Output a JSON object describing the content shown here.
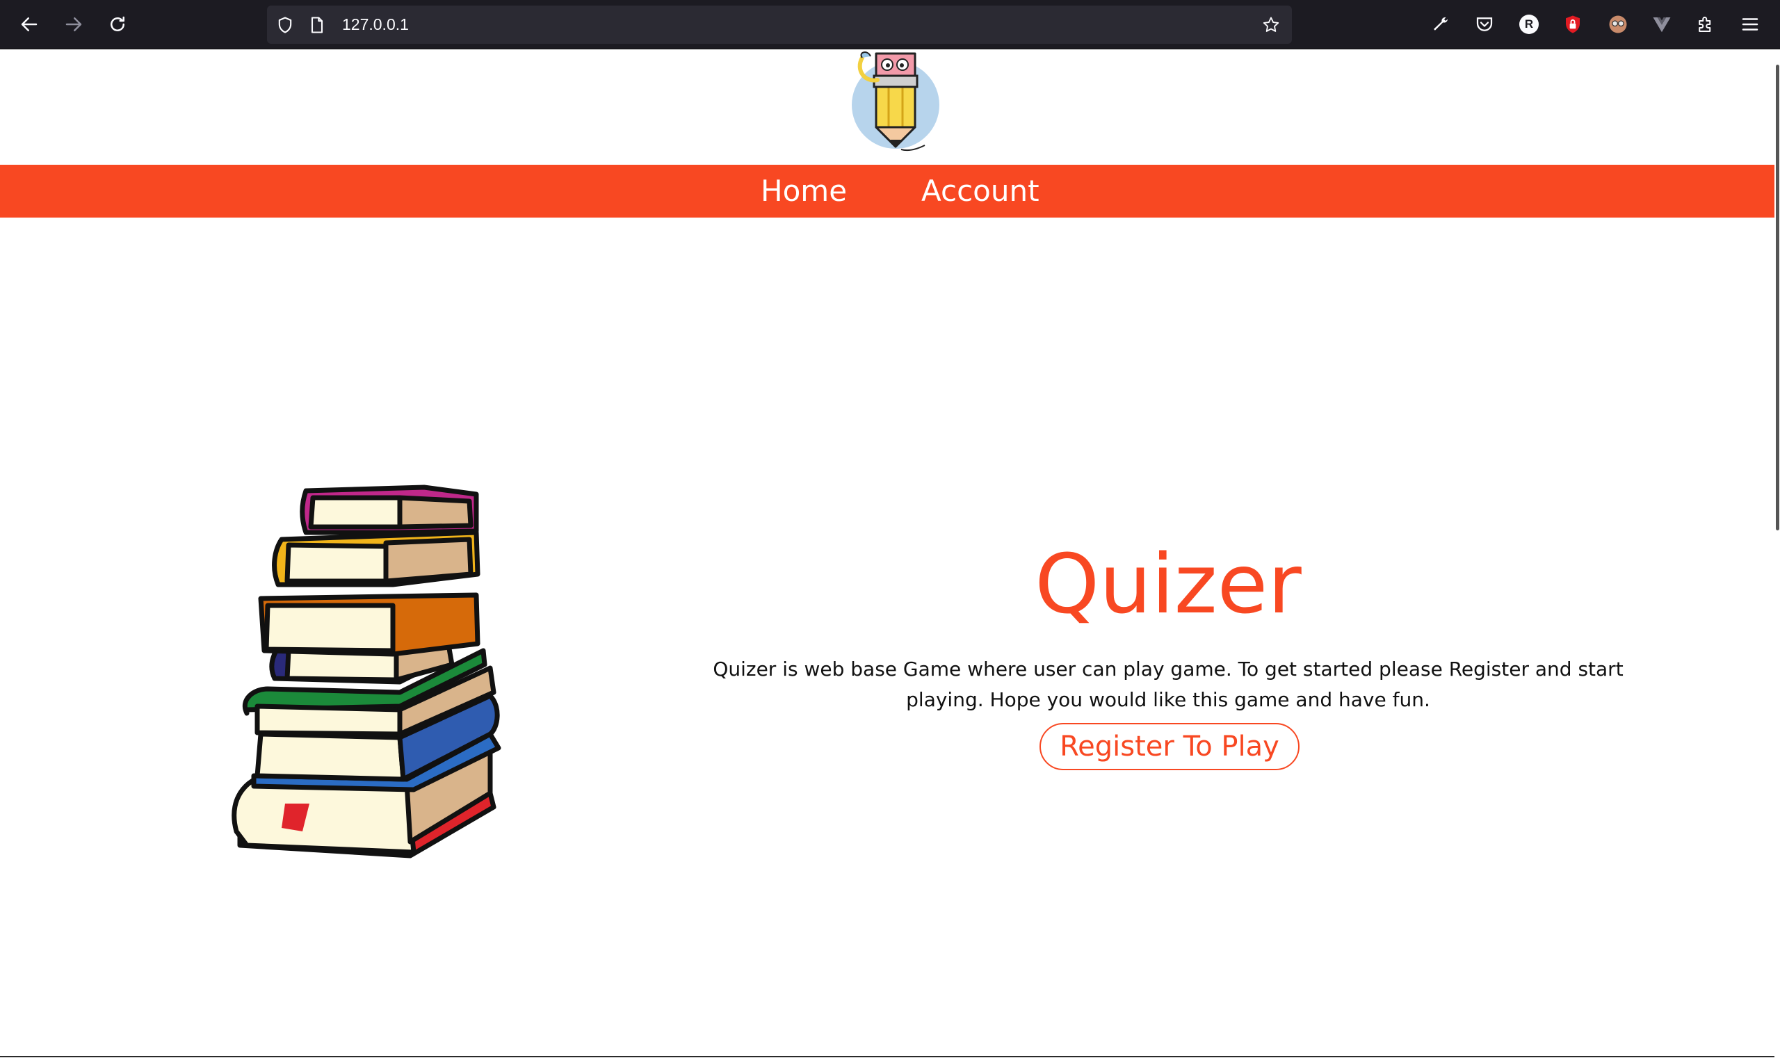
{
  "browser": {
    "url": "127.0.0.1",
    "icons": {
      "back": "arrow-left-icon",
      "forward": "arrow-right-icon",
      "reload": "reload-icon",
      "tracking": "shield-icon",
      "page": "page-icon",
      "bookmark": "star-icon",
      "devtools": "wrench-icon",
      "pocket": "pocket-icon",
      "profile_badge": "R",
      "extensions": "puzzle-icon",
      "menu": "hamburger-menu-icon"
    }
  },
  "site": {
    "nav": {
      "items": [
        {
          "label": "Home"
        },
        {
          "label": "Account"
        }
      ]
    },
    "hero": {
      "title": "Quizer",
      "description": "Quizer is web base Game where user can play game. To get started please Register and start playing. Hope you would like this game and have fun.",
      "cta_label": "Register To Play"
    }
  },
  "colors": {
    "accent": "#f84822",
    "chrome_bg": "#1c1b22",
    "urlbar_bg": "#2b2a33",
    "text": "#111111"
  }
}
